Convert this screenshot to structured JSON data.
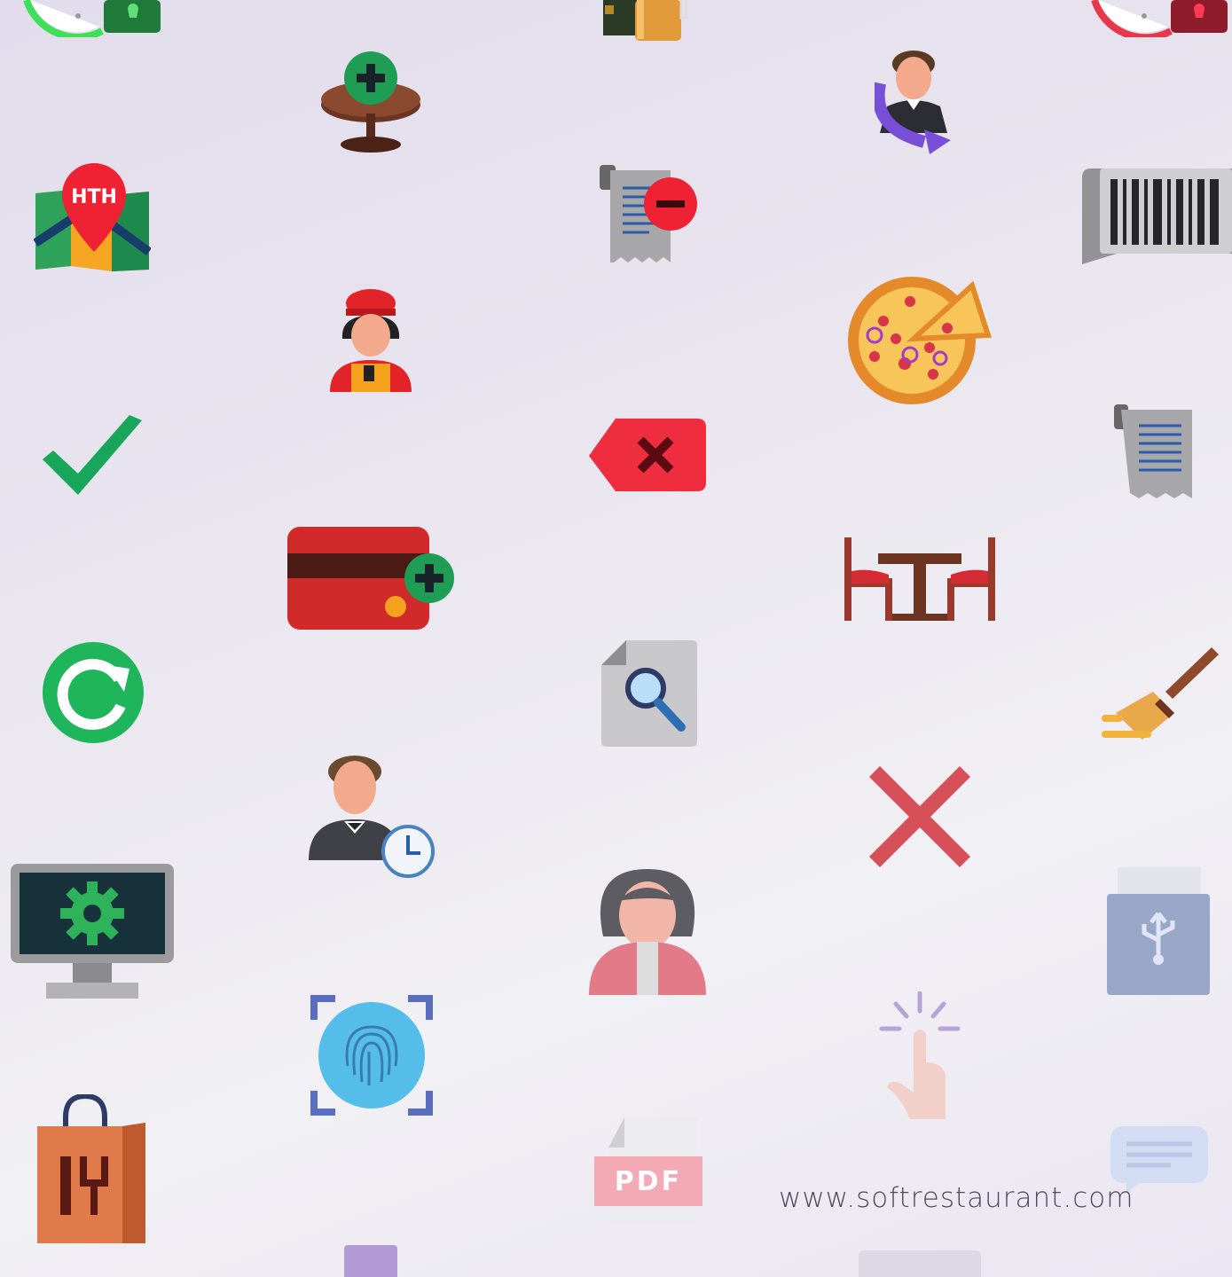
{
  "footer": {
    "url": "www.softrestaurant.com"
  },
  "icons": [
    {
      "name": "timer-lock-green-icon"
    },
    {
      "name": "drinks-icon"
    },
    {
      "name": "timer-lock-red-icon"
    },
    {
      "name": "add-table-icon"
    },
    {
      "name": "transfer-waiter-icon"
    },
    {
      "name": "map-location-icon"
    },
    {
      "name": "cancel-ticket-icon"
    },
    {
      "name": "barcode-icon"
    },
    {
      "name": "cashier-icon"
    },
    {
      "name": "pizza-slice-icon"
    },
    {
      "name": "checkmark-icon"
    },
    {
      "name": "backspace-delete-icon"
    },
    {
      "name": "receipt-icon"
    },
    {
      "name": "add-card-icon"
    },
    {
      "name": "dining-table-icon"
    },
    {
      "name": "refresh-icon"
    },
    {
      "name": "search-document-icon"
    },
    {
      "name": "broom-clean-icon"
    },
    {
      "name": "waiter-clock-icon"
    },
    {
      "name": "close-x-icon"
    },
    {
      "name": "monitor-settings-icon"
    },
    {
      "name": "female-user-icon"
    },
    {
      "name": "usb-drive-icon"
    },
    {
      "name": "fingerprint-icon"
    },
    {
      "name": "touch-click-icon"
    },
    {
      "name": "takeaway-bag-icon"
    },
    {
      "name": "pdf-file-icon"
    },
    {
      "name": "chat-message-icon"
    }
  ],
  "pdf_icon": {
    "label": "PDF"
  },
  "map_icon": {
    "label": "HTH"
  }
}
